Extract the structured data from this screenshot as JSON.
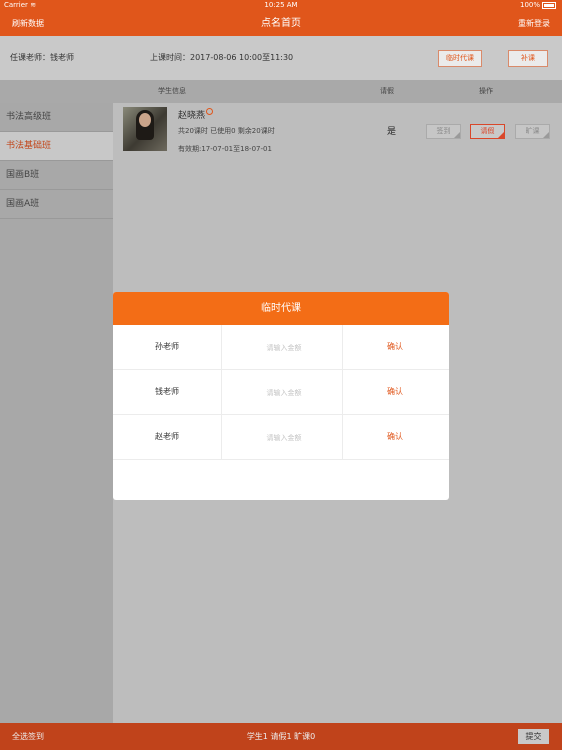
{
  "status_bar": {
    "carrier": "Carrier",
    "time": "10:25 AM",
    "battery": "100%"
  },
  "nav": {
    "left": "刷新数据",
    "title": "点名首页",
    "right": "重新登录"
  },
  "info": {
    "teacher": "任课老师：钱老师",
    "class_time": "上课时间：2017-08-06 10:00至11:30",
    "substitute_btn": "临时代课",
    "makeup_btn": "补课"
  },
  "table_header": {
    "student_info": "学生信息",
    "leave": "请假",
    "operation": "操作"
  },
  "sidebar": {
    "items": [
      {
        "label": "书法高级班",
        "active": false
      },
      {
        "label": "书法基础班",
        "active": true
      },
      {
        "label": "国画B班",
        "active": false
      },
      {
        "label": "国画A班",
        "active": false
      }
    ]
  },
  "students": [
    {
      "name": "赵晓燕",
      "hours": "共20课时 已使用0 剩余20课时",
      "valid": "有效期:17-07-01至18-07-01",
      "leave": "是",
      "actions": {
        "sign": "签到",
        "leave": "请假",
        "absent": "旷课"
      }
    }
  ],
  "modal": {
    "title": "临时代课",
    "rows": [
      {
        "teacher": "孙老师",
        "placeholder": "请输入金额",
        "confirm": "确认"
      },
      {
        "teacher": "钱老师",
        "placeholder": "请输入金额",
        "confirm": "确认"
      },
      {
        "teacher": "赵老师",
        "placeholder": "请输入金额",
        "confirm": "确认"
      }
    ]
  },
  "bottom": {
    "select_all": "全选签到",
    "summary": "学生1  请假1  旷课0",
    "submit": "提交"
  },
  "colors": {
    "brand": "#e0561b",
    "modal_header": "#f36d16",
    "bottom_bar": "#c0431b"
  }
}
